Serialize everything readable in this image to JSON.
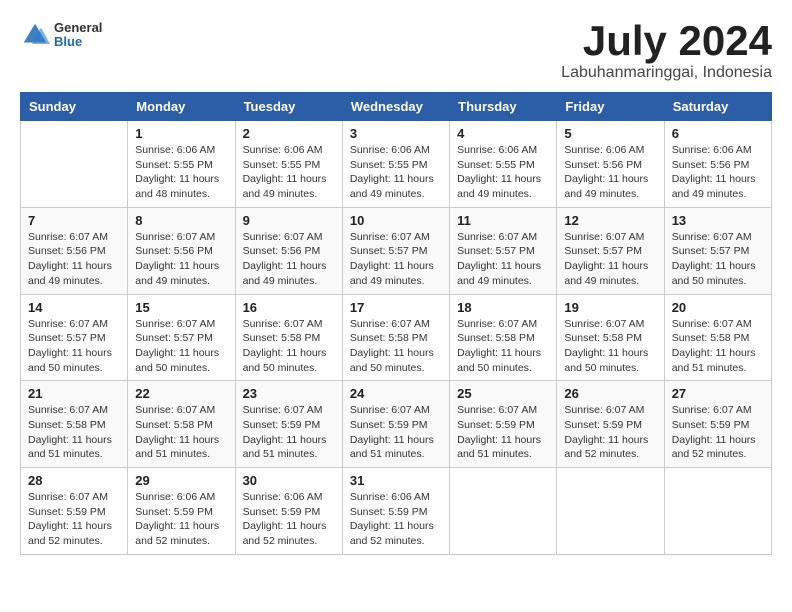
{
  "header": {
    "logo": {
      "general": "General",
      "blue": "Blue"
    },
    "title": "July 2024",
    "subtitle": "Labuhanmaringgai, Indonesia"
  },
  "calendar": {
    "days_of_week": [
      "Sunday",
      "Monday",
      "Tuesday",
      "Wednesday",
      "Thursday",
      "Friday",
      "Saturday"
    ],
    "weeks": [
      [
        {
          "day": "",
          "info": ""
        },
        {
          "day": "1",
          "info": "Sunrise: 6:06 AM\nSunset: 5:55 PM\nDaylight: 11 hours\nand 48 minutes."
        },
        {
          "day": "2",
          "info": "Sunrise: 6:06 AM\nSunset: 5:55 PM\nDaylight: 11 hours\nand 49 minutes."
        },
        {
          "day": "3",
          "info": "Sunrise: 6:06 AM\nSunset: 5:55 PM\nDaylight: 11 hours\nand 49 minutes."
        },
        {
          "day": "4",
          "info": "Sunrise: 6:06 AM\nSunset: 5:55 PM\nDaylight: 11 hours\nand 49 minutes."
        },
        {
          "day": "5",
          "info": "Sunrise: 6:06 AM\nSunset: 5:56 PM\nDaylight: 11 hours\nand 49 minutes."
        },
        {
          "day": "6",
          "info": "Sunrise: 6:06 AM\nSunset: 5:56 PM\nDaylight: 11 hours\nand 49 minutes."
        }
      ],
      [
        {
          "day": "7",
          "info": "Sunrise: 6:07 AM\nSunset: 5:56 PM\nDaylight: 11 hours\nand 49 minutes."
        },
        {
          "day": "8",
          "info": "Sunrise: 6:07 AM\nSunset: 5:56 PM\nDaylight: 11 hours\nand 49 minutes."
        },
        {
          "day": "9",
          "info": "Sunrise: 6:07 AM\nSunset: 5:56 PM\nDaylight: 11 hours\nand 49 minutes."
        },
        {
          "day": "10",
          "info": "Sunrise: 6:07 AM\nSunset: 5:57 PM\nDaylight: 11 hours\nand 49 minutes."
        },
        {
          "day": "11",
          "info": "Sunrise: 6:07 AM\nSunset: 5:57 PM\nDaylight: 11 hours\nand 49 minutes."
        },
        {
          "day": "12",
          "info": "Sunrise: 6:07 AM\nSunset: 5:57 PM\nDaylight: 11 hours\nand 49 minutes."
        },
        {
          "day": "13",
          "info": "Sunrise: 6:07 AM\nSunset: 5:57 PM\nDaylight: 11 hours\nand 50 minutes."
        }
      ],
      [
        {
          "day": "14",
          "info": "Sunrise: 6:07 AM\nSunset: 5:57 PM\nDaylight: 11 hours\nand 50 minutes."
        },
        {
          "day": "15",
          "info": "Sunrise: 6:07 AM\nSunset: 5:57 PM\nDaylight: 11 hours\nand 50 minutes."
        },
        {
          "day": "16",
          "info": "Sunrise: 6:07 AM\nSunset: 5:58 PM\nDaylight: 11 hours\nand 50 minutes."
        },
        {
          "day": "17",
          "info": "Sunrise: 6:07 AM\nSunset: 5:58 PM\nDaylight: 11 hours\nand 50 minutes."
        },
        {
          "day": "18",
          "info": "Sunrise: 6:07 AM\nSunset: 5:58 PM\nDaylight: 11 hours\nand 50 minutes."
        },
        {
          "day": "19",
          "info": "Sunrise: 6:07 AM\nSunset: 5:58 PM\nDaylight: 11 hours\nand 50 minutes."
        },
        {
          "day": "20",
          "info": "Sunrise: 6:07 AM\nSunset: 5:58 PM\nDaylight: 11 hours\nand 51 minutes."
        }
      ],
      [
        {
          "day": "21",
          "info": "Sunrise: 6:07 AM\nSunset: 5:58 PM\nDaylight: 11 hours\nand 51 minutes."
        },
        {
          "day": "22",
          "info": "Sunrise: 6:07 AM\nSunset: 5:58 PM\nDaylight: 11 hours\nand 51 minutes."
        },
        {
          "day": "23",
          "info": "Sunrise: 6:07 AM\nSunset: 5:59 PM\nDaylight: 11 hours\nand 51 minutes."
        },
        {
          "day": "24",
          "info": "Sunrise: 6:07 AM\nSunset: 5:59 PM\nDaylight: 11 hours\nand 51 minutes."
        },
        {
          "day": "25",
          "info": "Sunrise: 6:07 AM\nSunset: 5:59 PM\nDaylight: 11 hours\nand 51 minutes."
        },
        {
          "day": "26",
          "info": "Sunrise: 6:07 AM\nSunset: 5:59 PM\nDaylight: 11 hours\nand 52 minutes."
        },
        {
          "day": "27",
          "info": "Sunrise: 6:07 AM\nSunset: 5:59 PM\nDaylight: 11 hours\nand 52 minutes."
        }
      ],
      [
        {
          "day": "28",
          "info": "Sunrise: 6:07 AM\nSunset: 5:59 PM\nDaylight: 11 hours\nand 52 minutes."
        },
        {
          "day": "29",
          "info": "Sunrise: 6:06 AM\nSunset: 5:59 PM\nDaylight: 11 hours\nand 52 minutes."
        },
        {
          "day": "30",
          "info": "Sunrise: 6:06 AM\nSunset: 5:59 PM\nDaylight: 11 hours\nand 52 minutes."
        },
        {
          "day": "31",
          "info": "Sunrise: 6:06 AM\nSunset: 5:59 PM\nDaylight: 11 hours\nand 52 minutes."
        },
        {
          "day": "",
          "info": ""
        },
        {
          "day": "",
          "info": ""
        },
        {
          "day": "",
          "info": ""
        }
      ]
    ]
  }
}
